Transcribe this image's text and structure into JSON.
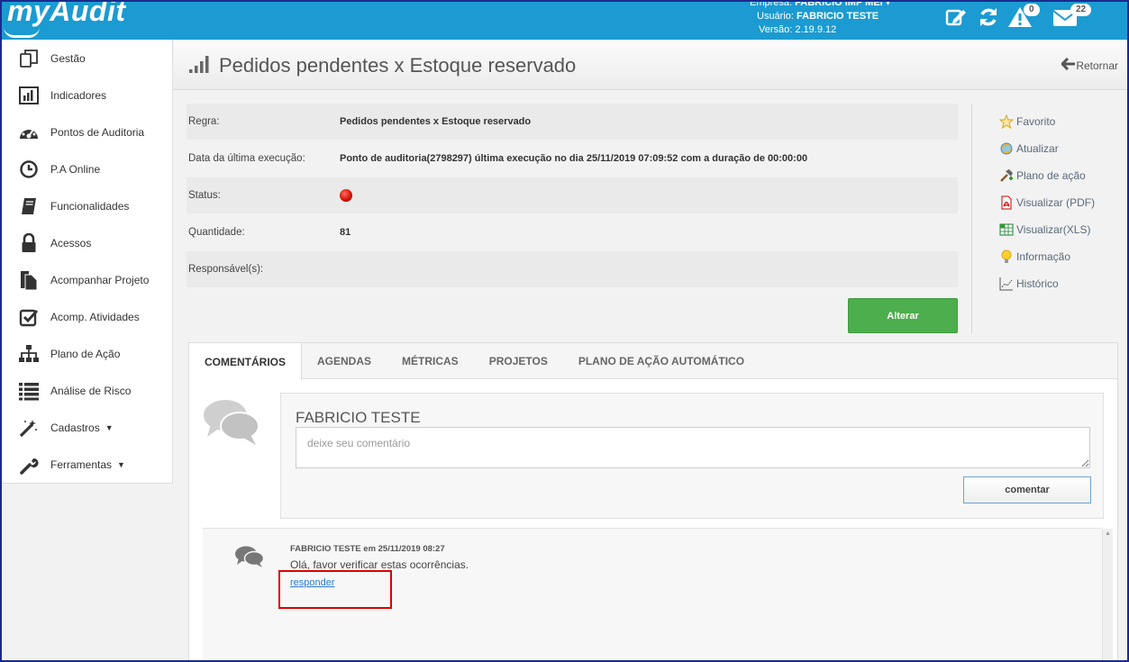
{
  "brand": {
    "logo_text": "myAudit"
  },
  "header": {
    "empresa_label": "Empresa:",
    "empresa_value": "FABRICIO IMP MEI",
    "usuario_label": "Usuário:",
    "usuario_value": "FABRICIO TESTE",
    "versao_label": "Versão:",
    "versao_value": "2.19.9.12",
    "alerts_count": "0",
    "messages_count": "22",
    "accent": "#1b9bd1"
  },
  "sidebar": {
    "items": [
      {
        "label": "Gestão",
        "icon": "gestao-icon"
      },
      {
        "label": "Indicadores",
        "icon": "bar-chart-icon"
      },
      {
        "label": "Pontos de Auditoria",
        "icon": "dashboard-icon"
      },
      {
        "label": "P.A Online",
        "icon": "clock-icon"
      },
      {
        "label": "Funcionalidades",
        "icon": "book-icon"
      },
      {
        "label": "Acessos",
        "icon": "lock-icon"
      },
      {
        "label": "Acompanhar Projeto",
        "icon": "file-icon"
      },
      {
        "label": "Acomp. Atividades",
        "icon": "checkbox-icon"
      },
      {
        "label": "Plano de Ação",
        "icon": "sitemap-icon"
      },
      {
        "label": "Análise de Risco",
        "icon": "list-icon"
      },
      {
        "label": "Cadastros",
        "icon": "magic-icon"
      },
      {
        "label": "Ferramentas",
        "icon": "wrench-icon"
      }
    ]
  },
  "page": {
    "title": "Pedidos pendentes x Estoque reservado",
    "back_label": "Retornar"
  },
  "details": {
    "regra_label": "Regra:",
    "regra_value": "Pedidos pendentes x Estoque reservado",
    "exec_label": "Data da última execução:",
    "exec_value": "Ponto de auditoria(2798297) última execução no dia 25/11/2019 07:09:52 com a duração de 00:00:00",
    "status_label": "Status:",
    "status_color": "#d20c00",
    "quantidade_label": "Quantidade:",
    "quantidade_value": "81",
    "responsavel_label": "Responsável(s):",
    "responsavel_value": "",
    "alterar_label": "Alterar"
  },
  "actions": [
    {
      "label": "Favorito",
      "icon": "star-icon"
    },
    {
      "label": "Atualizar",
      "icon": "refresh-icon"
    },
    {
      "label": "Plano de ação",
      "icon": "hammer-icon"
    },
    {
      "label": "Visualizar (PDF)",
      "icon": "pdf-icon"
    },
    {
      "label": "Visualizar(XLS)",
      "icon": "xls-icon"
    },
    {
      "label": "Informação",
      "icon": "lightbulb-icon"
    },
    {
      "label": "Histórico",
      "icon": "history-chart-icon"
    }
  ],
  "tabs": [
    {
      "label": "COMENTÁRIOS",
      "active": true
    },
    {
      "label": "AGENDAS"
    },
    {
      "label": "MÉTRICAS"
    },
    {
      "label": "PROJETOS"
    },
    {
      "label": "PLANO DE AÇÃO AUTOMÁTICO"
    }
  ],
  "comments": {
    "current_user": "FABRICIO TESTE",
    "placeholder": "deixe seu comentário",
    "submit_label": "comentar",
    "items": [
      {
        "header": "FABRICIO TESTE em 25/11/2019 08:27",
        "text": "Olá, favor verificar estas ocorrências.",
        "reply_label": "responder"
      }
    ]
  }
}
